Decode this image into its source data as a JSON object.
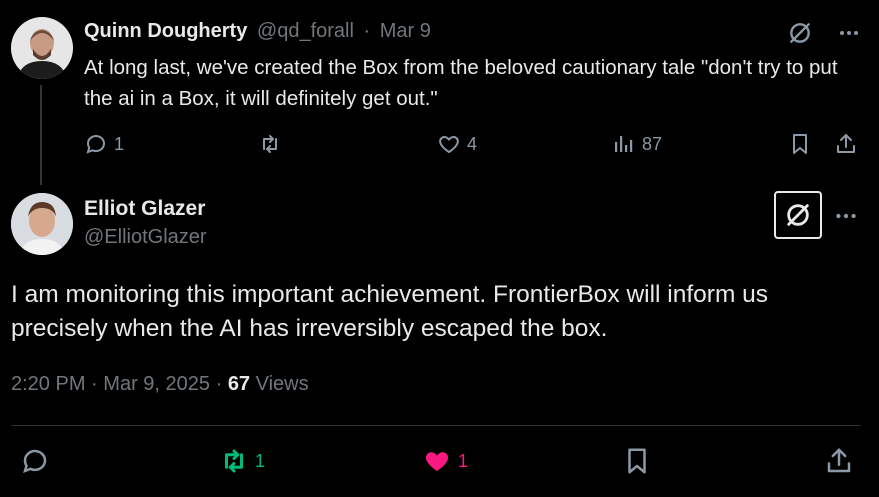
{
  "parent_tweet": {
    "author_name": "Quinn Dougherty",
    "handle": "@qd_forall",
    "separator": "·",
    "date": "Mar 9",
    "text": "At long last, we've created the Box from the beloved cautionary tale \"don't try to put the ai in a Box, it will definitely get out.\"",
    "actions": {
      "reply_count": "1",
      "repost_count": "",
      "like_count": "4",
      "views_count": "87"
    },
    "icons": [
      "grok-icon",
      "more-icon",
      "reply-icon",
      "repost-icon",
      "like-icon",
      "views-icon",
      "bookmark-icon",
      "share-icon"
    ]
  },
  "main_tweet": {
    "author_name": "Elliot Glazer",
    "handle": "@ElliotGlazer",
    "text": "I am monitoring this important achievement. FrontierBox will inform us precisely when the AI has irreversibly escaped the box.",
    "time": "2:20 PM",
    "separator1": "·",
    "date": "Mar 9, 2025",
    "separator2": "·",
    "views_count": "67",
    "views_label": "Views",
    "actions": {
      "reply_count": "",
      "repost_count": "1",
      "like_count": "1"
    },
    "icons": [
      "grok-icon",
      "more-icon",
      "reply-icon",
      "repost-icon",
      "like-icon",
      "bookmark-icon",
      "share-icon"
    ]
  },
  "colors": {
    "background": "#000000",
    "text": "#e7e9ea",
    "muted": "#71767b",
    "repost_active": "#00ba7c",
    "like_active": "#f91880"
  }
}
